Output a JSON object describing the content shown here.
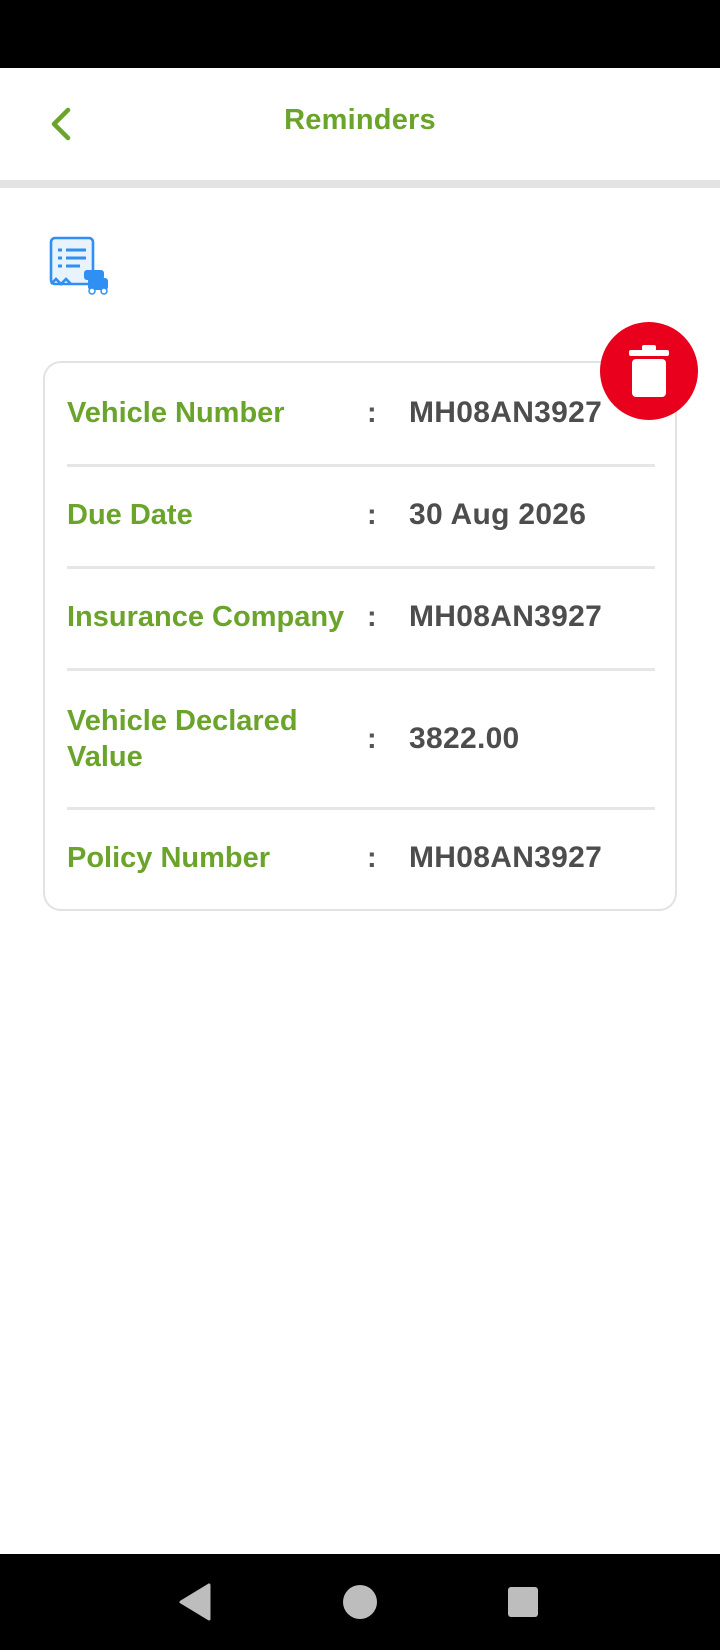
{
  "header": {
    "title": "Reminders",
    "back_icon": "chevron-left-icon"
  },
  "colors": {
    "accent": "#6aa42a",
    "delete": "#e8001c",
    "icon_blue": "#2f8ff2"
  },
  "reminder": {
    "type_icon": "insurance-receipt-icon",
    "delete_icon": "trash-icon",
    "rows": [
      {
        "label": "Vehicle Number",
        "value": "MH08AN3927"
      },
      {
        "label": "Due Date",
        "value": "30 Aug 2026"
      },
      {
        "label": "Insurance Company",
        "value": "MH08AN3927"
      },
      {
        "label": "Vehicle Declared Value",
        "value": "3822.00"
      },
      {
        "label": "Policy Number",
        "value": "MH08AN3927"
      }
    ],
    "separator": ":"
  },
  "nav": {
    "back_icon": "triangle-back-icon",
    "home_icon": "circle-home-icon",
    "recents_icon": "square-recents-icon"
  }
}
